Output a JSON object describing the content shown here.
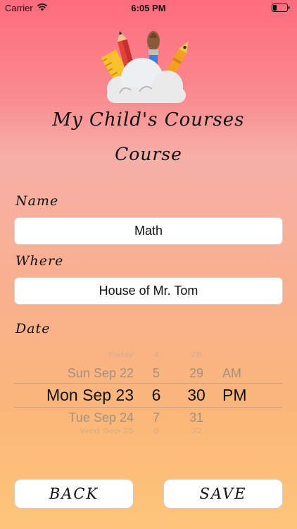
{
  "status_bar": {
    "carrier": "Carrier",
    "time": "6:05 PM"
  },
  "header": {
    "app_title": "My Child's Courses",
    "page_title": "Course"
  },
  "form": {
    "name": {
      "label": "Name",
      "value": "Math"
    },
    "where": {
      "label": "Where",
      "value": "House of Mr. Tom"
    },
    "date": {
      "label": "Date"
    }
  },
  "date_picker": {
    "dates": [
      "Today",
      "Sun Sep 22",
      "Mon Sep 23",
      "Tue Sep 24",
      "Wed Sep 25"
    ],
    "hours": [
      "4",
      "5",
      "6",
      "7",
      "8"
    ],
    "minutes": [
      "28",
      "29",
      "30",
      "31",
      "32"
    ],
    "ampm": [
      "",
      "AM",
      "PM",
      "",
      ""
    ],
    "selected": {
      "date": "Mon Sep 23",
      "hour": "6",
      "minute": "30",
      "ampm": "PM"
    }
  },
  "buttons": {
    "back": "BACK",
    "save": "SAVE"
  }
}
